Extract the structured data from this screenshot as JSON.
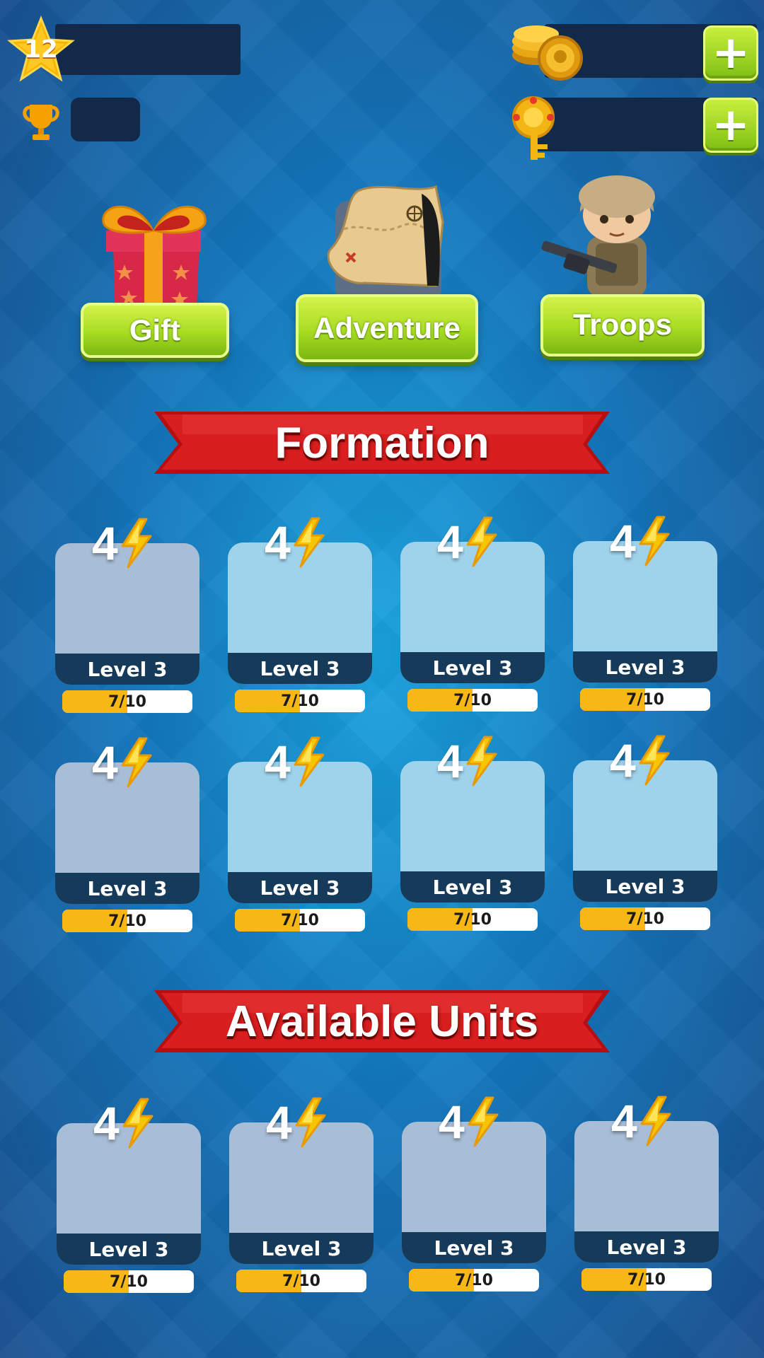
{
  "hud": {
    "player_level": "12",
    "trophy_icon": "trophy-icon",
    "coin_icon": "coin-stack-icon",
    "key_icon": "gold-key-icon",
    "add_label": "+"
  },
  "shop": {
    "gift_label": "Gift",
    "adventure_label": "Adventure",
    "troops_label": "Troops"
  },
  "sections": {
    "formation_title": "Formation",
    "available_title": "Available Units"
  },
  "formation_cards": [
    {
      "energy": "4",
      "level": "Level 3",
      "progress": "7/10",
      "fraction": 0.5
    },
    {
      "energy": "4",
      "level": "Level 3",
      "progress": "7/10",
      "fraction": 0.5
    },
    {
      "energy": "4",
      "level": "Level 3",
      "progress": "7/10",
      "fraction": 0.5
    },
    {
      "energy": "4",
      "level": "Level 3",
      "progress": "7/10",
      "fraction": 0.5
    },
    {
      "energy": "4",
      "level": "Level 3",
      "progress": "7/10",
      "fraction": 0.5
    },
    {
      "energy": "4",
      "level": "Level 3",
      "progress": "7/10",
      "fraction": 0.5
    },
    {
      "energy": "4",
      "level": "Level 3",
      "progress": "7/10",
      "fraction": 0.5
    },
    {
      "energy": "4",
      "level": "Level 3",
      "progress": "7/10",
      "fraction": 0.5
    }
  ],
  "available_cards": [
    {
      "energy": "4",
      "level": "Level 3",
      "progress": "7/10",
      "fraction": 0.5
    },
    {
      "energy": "4",
      "level": "Level 3",
      "progress": "7/10",
      "fraction": 0.5
    },
    {
      "energy": "4",
      "level": "Level 3",
      "progress": "7/10",
      "fraction": 0.5
    },
    {
      "energy": "4",
      "level": "Level 3",
      "progress": "7/10",
      "fraction": 0.5
    }
  ],
  "colors": {
    "accent_green": "#a8dc22",
    "ribbon_red": "#d01818",
    "progress_orange": "#f7b714",
    "card_footer": "#163a5a"
  }
}
